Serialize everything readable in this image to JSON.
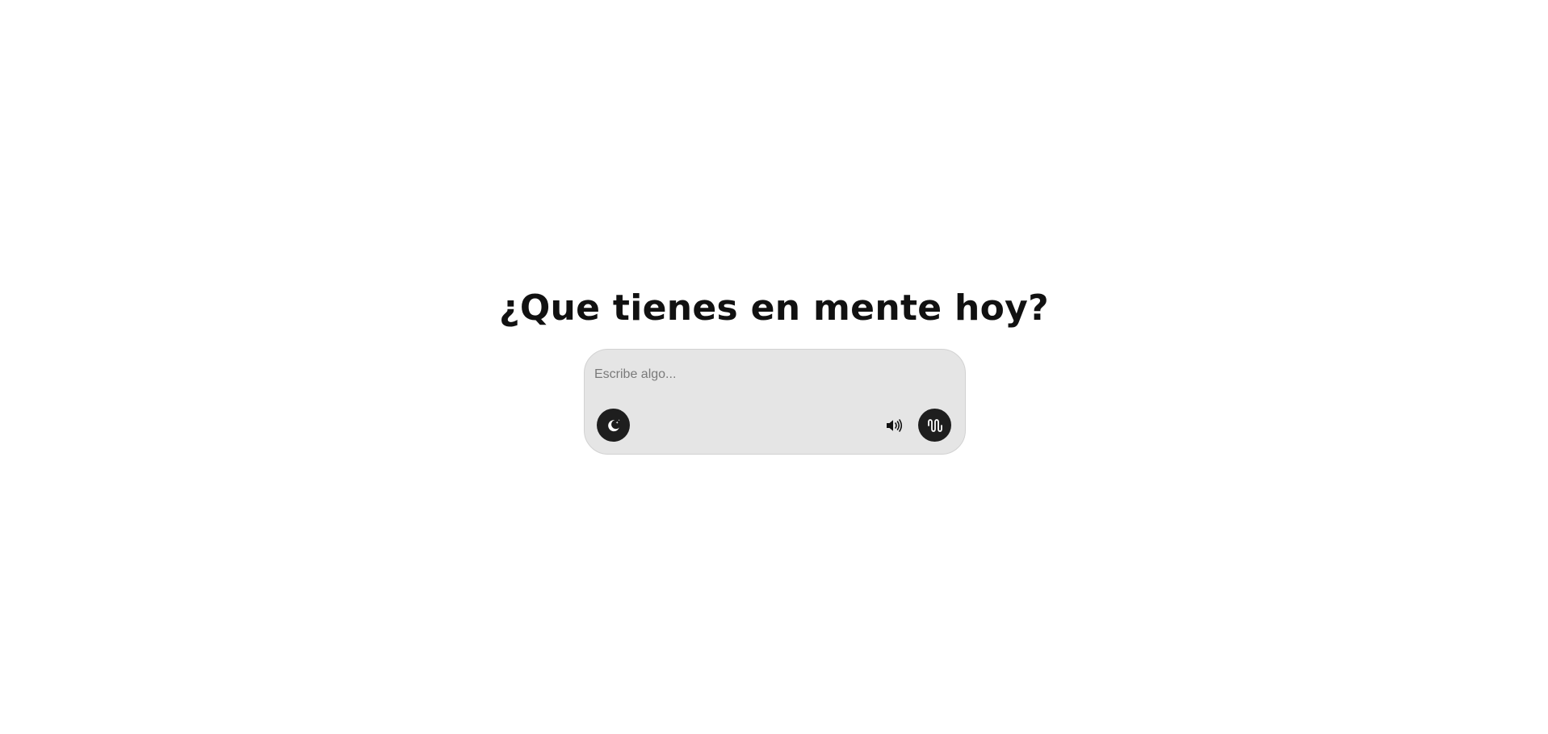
{
  "main": {
    "heading": "¿Que tienes en mente hoy?"
  },
  "composer": {
    "placeholder": "Escribe algo...",
    "value": "",
    "actions": {
      "theme_icon": "moon-stars-icon",
      "speaker_icon": "speaker-volume-icon",
      "voice_icon": "audio-waveform-icon"
    }
  },
  "colors": {
    "background": "#ffffff",
    "composer_background": "#e5e5e5",
    "button_background": "#1e1e1e",
    "heading_text": "#111111"
  }
}
